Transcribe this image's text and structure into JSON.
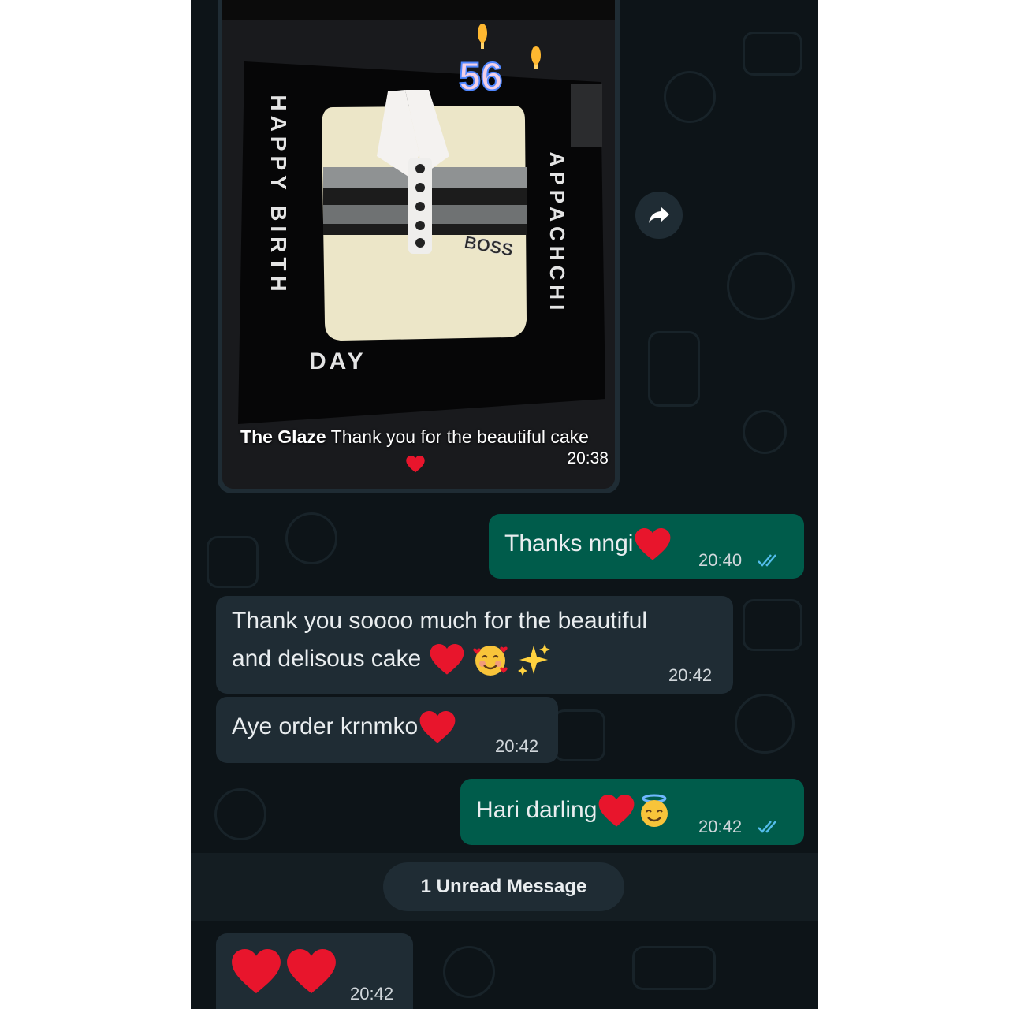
{
  "chat": {
    "image_message": {
      "caption_bold": "The Glaze",
      "caption_text": "Thank you for the beautiful cake",
      "time": "20:38",
      "cake_text": {
        "left": "HAPPY BIRTH",
        "bottom": "DAY",
        "right": "APPACHCHI",
        "badge": "BOSS",
        "candles": "56"
      }
    },
    "messages": [
      {
        "direction": "outgoing",
        "text": "Thanks nngi",
        "emoji": [
          "red-heart"
        ],
        "time": "20:40",
        "status": "read"
      },
      {
        "direction": "incoming",
        "line1": "Thank you soooo much for the beautiful",
        "line2": "and delisous cake",
        "emoji": [
          "red-heart",
          "smiling-face-with-hearts",
          "sparkles"
        ],
        "time": "20:42"
      },
      {
        "direction": "incoming",
        "text": "Aye order krnmko",
        "emoji": [
          "red-heart"
        ],
        "time": "20:42"
      },
      {
        "direction": "outgoing",
        "text": "Hari darling",
        "emoji": [
          "red-heart",
          "smiling-face-with-halo"
        ],
        "time": "20:42",
        "status": "read"
      },
      {
        "direction": "incoming",
        "text": "",
        "emoji": [
          "red-heart",
          "red-heart"
        ],
        "time": "20:42"
      }
    ],
    "unread_banner": "1 Unread Message",
    "forward_icon": "forward-arrow-icon"
  },
  "colors": {
    "chat_background": "#0d1418",
    "incoming_bubble": "#1f2c34",
    "outgoing_bubble": "#005c4b",
    "read_tick": "#53bdeb",
    "heart": "#e8152c"
  }
}
